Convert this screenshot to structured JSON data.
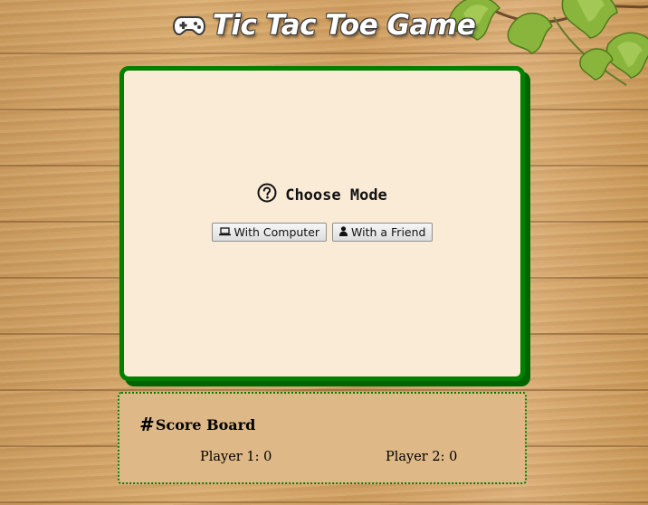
{
  "header": {
    "title": "Tic Tac Toe Game",
    "icon": "gamepad-icon"
  },
  "mode_selector": {
    "heading": "Choose Mode",
    "heading_icon": "question-circle-icon",
    "buttons": [
      {
        "label": "With Computer",
        "icon": "laptop-icon"
      },
      {
        "label": "With a Friend",
        "icon": "user-icon"
      }
    ]
  },
  "scoreboard": {
    "heading": "Score Board",
    "heading_icon": "hash-icon",
    "player1": "Player 1: 0",
    "player2": "Player 2: 0"
  },
  "colors": {
    "board_background": "#faebd7",
    "board_border": "#008000",
    "scoreboard_background": "#deb887"
  }
}
